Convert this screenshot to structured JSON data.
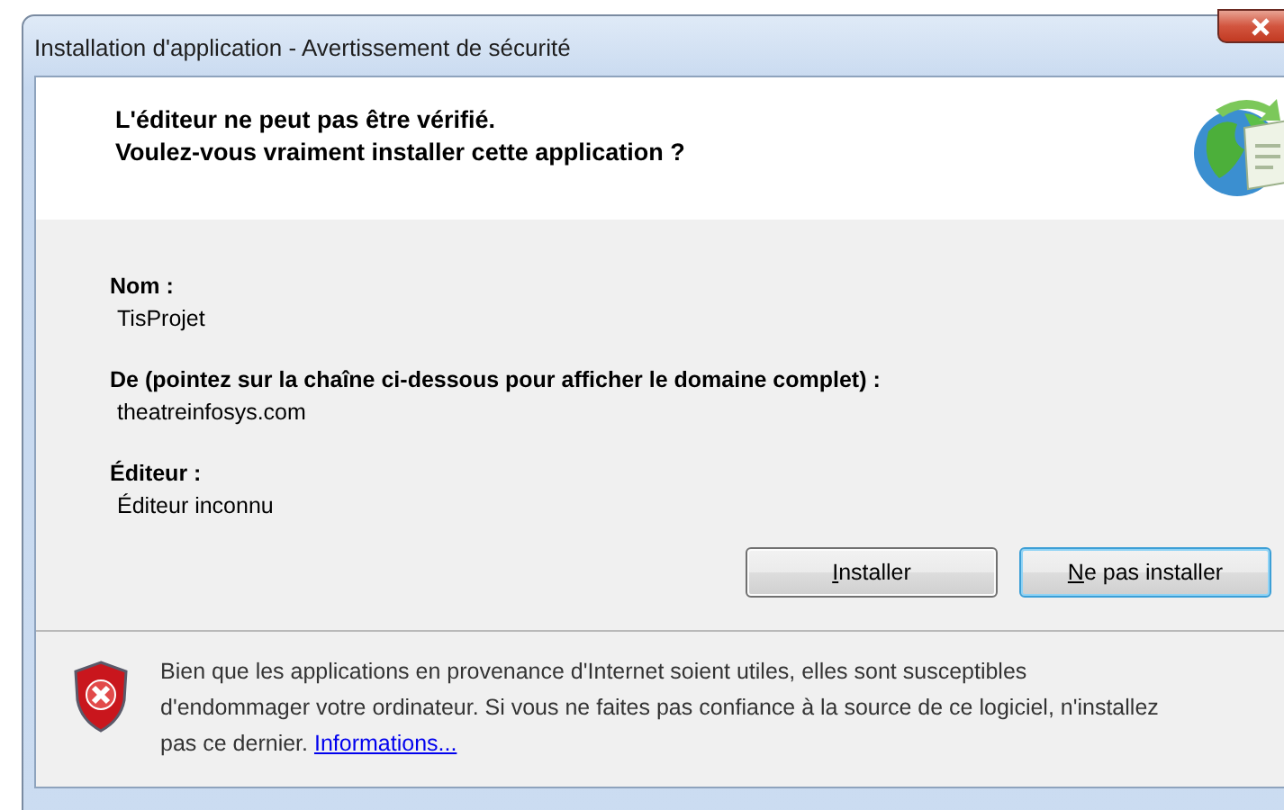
{
  "window": {
    "title": "Installation d'application - Avertissement de sécurité"
  },
  "header": {
    "lines": [
      "L'éditeur ne peut pas être vérifié.",
      "Voulez-vous vraiment installer cette application ?"
    ]
  },
  "fields": [
    {
      "label": "Nom :",
      "value": "TisProjet"
    },
    {
      "label": "De (pointez sur la chaîne ci-dessous pour afficher le domaine complet) :",
      "value": "theatreinfosys.com"
    },
    {
      "label": "Éditeur :",
      "value": "Éditeur inconnu"
    }
  ],
  "buttons": [
    {
      "label": "Installer",
      "focused": false
    },
    {
      "label": "Ne pas installer",
      "focused": true
    }
  ],
  "warning": {
    "text": "Bien que les applications en provenance d'Internet soient utiles, elles sont susceptibles d'endommager votre ordinateur. Si vous ne faites pas confiance à la source de ce logiciel, n'installez pas ce dernier.",
    "link": "Informations..."
  }
}
